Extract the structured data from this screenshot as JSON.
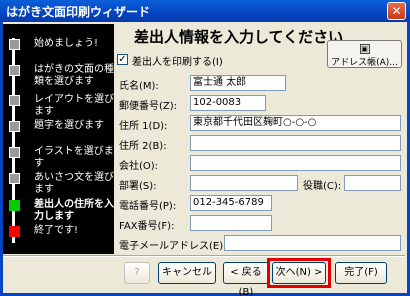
{
  "window": {
    "title": "はがき文面印刷ウィザード",
    "close_label": "✕"
  },
  "steps": [
    {
      "label": "始めましょう!"
    },
    {
      "label": "はがきの文面の種類を選びます"
    },
    {
      "label": "レイアウトを選びます"
    },
    {
      "label": "題字を選びます"
    },
    {
      "label": "イラストを選びます"
    },
    {
      "label": "あいさつ文を選びます"
    },
    {
      "label": "差出人の住所を入力します"
    },
    {
      "label": "終了です!"
    }
  ],
  "main": {
    "heading": "差出人情報を入力してください",
    "print_checkbox_label": "差出人を印刷する(I)",
    "print_checked": true,
    "address_book_button": "アドレス帳(A)...",
    "fields": {
      "name_label": "氏名(M):",
      "name_value": "富士通 太郎",
      "zip_label": "郵便番号(Z):",
      "zip_value": "102-0083",
      "addr1_label": "住所 1(D):",
      "addr1_value": "東京都千代田区麹町○-○-○",
      "addr2_label": "住所 2(B):",
      "addr2_value": "",
      "company_label": "会社(O):",
      "company_value": "",
      "dept_label": "部署(S):",
      "dept_value": "",
      "position_label": "役職(C):",
      "position_value": "",
      "phone_label": "電話番号(P):",
      "phone_value": "012-345-6789",
      "fax_label": "FAX番号(F):",
      "fax_value": "",
      "email_label": "電子メールアドレス(E):",
      "email_value": ""
    }
  },
  "buttons": {
    "help": "?",
    "cancel": "キャンセル",
    "back": "< 戻る(B)",
    "next": "次へ(N) >",
    "finish": "完了(F)"
  }
}
